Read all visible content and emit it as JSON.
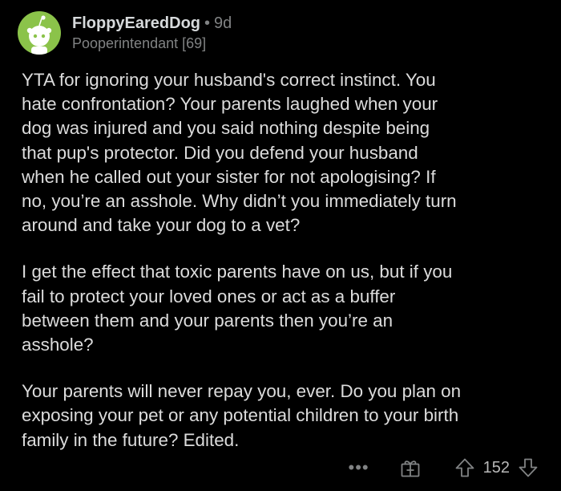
{
  "comment": {
    "username": "FloppyEaredDog",
    "separator": "•",
    "age": "9d",
    "flair": "Pooperintendant [69]",
    "avatar_color": "#8bc34a",
    "paragraphs": [
      "YTA for ignoring your husband's correct instinct.  You\nhate confrontation?  Your parents laughed when your\ndog was injured and you said nothing despite being\nthat pup's protector.  Did you defend your husband\nwhen he called out your sister for not apologising?  If\nno, you’re an asshole.  Why didn’t you immediately turn\naround and take your dog to a vet?",
      "I get the effect that toxic parents have on us, but if you\nfail to protect your loved ones or act as a buffer\nbetween them and your parents then you’re an\nasshole?",
      "Your parents will never repay you, ever.  Do you plan on\nexposing your pet or any potential children to your birth\nfamily in the future?  Edited."
    ],
    "actions": {
      "more_label": "•••",
      "award_icon": "gift-icon",
      "upvote_icon": "upvote-arrow-icon",
      "score": "152",
      "downvote_icon": "downvote-arrow-icon"
    }
  }
}
